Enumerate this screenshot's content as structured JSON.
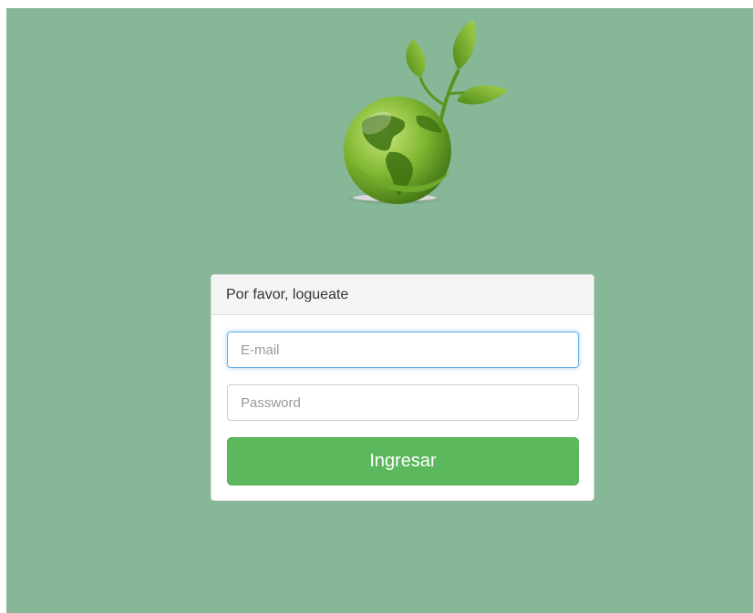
{
  "colors": {
    "background": "#86b898",
    "button": "#5cb85c",
    "focus_border": "#66afe9"
  },
  "logo": {
    "icon": "globe-with-leaves-icon"
  },
  "login_panel": {
    "heading": "Por favor, logueate",
    "email": {
      "placeholder": "E-mail",
      "value": ""
    },
    "password": {
      "placeholder": "Password",
      "value": ""
    },
    "submit_label": "Ingresar"
  }
}
